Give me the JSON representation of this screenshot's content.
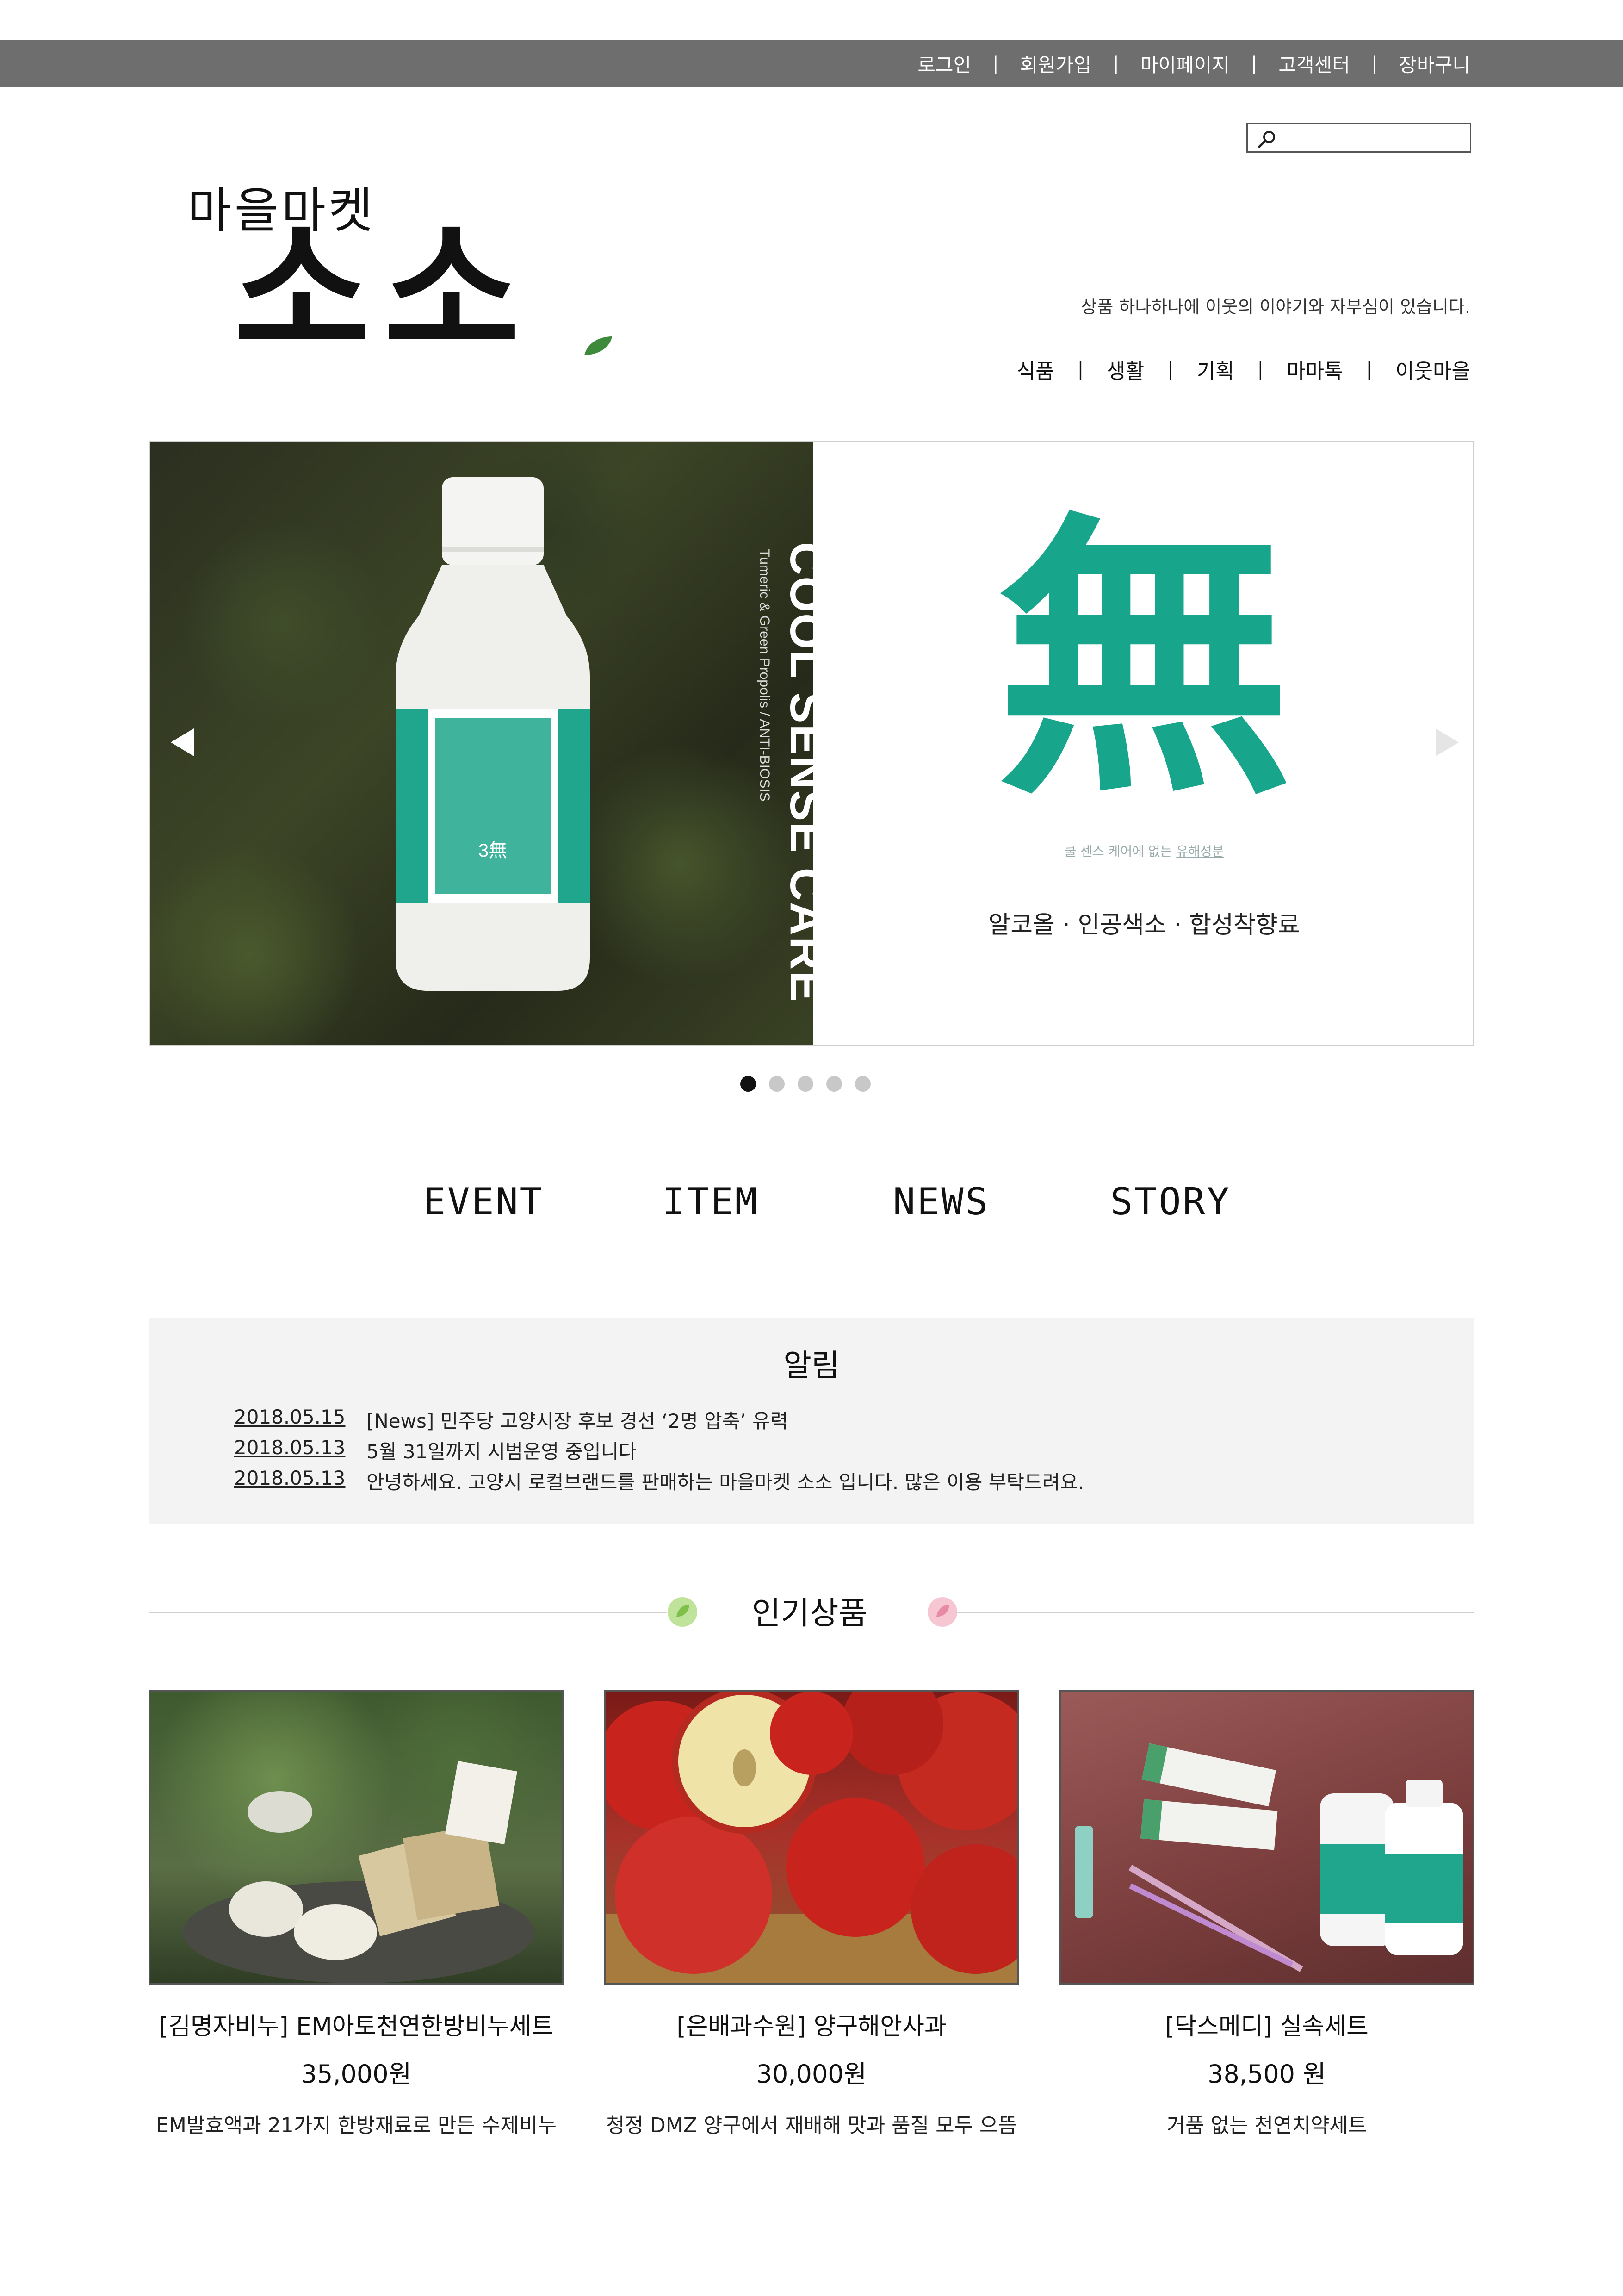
{
  "top_nav": [
    {
      "label": "로그인"
    },
    {
      "label": "회원가입"
    },
    {
      "label": "마이페이지"
    },
    {
      "label": "고객센터"
    },
    {
      "label": "장바구니"
    }
  ],
  "search": {
    "placeholder": "",
    "icon": "search-icon"
  },
  "logo": {
    "small": "마을마켓",
    "big": "소소"
  },
  "tagline": "상품 하나하나에 이웃의 이야기와 자부심이 있습니다.",
  "category_nav": [
    {
      "label": "식품"
    },
    {
      "label": "생활"
    },
    {
      "label": "기획"
    },
    {
      "label": "마마톡"
    },
    {
      "label": "이웃마을"
    }
  ],
  "hero": {
    "bottle_brand": "COOL SENSE CARE",
    "bottle_sub": "Tumeric & Green Propolis / ANTI-BIOSIS",
    "symbol": "無",
    "caption_prefix": "쿨 센스 케어에 없는 ",
    "caption_underlined": "유해성분",
    "headline": "알코올 · 인공색소 · 합성착향료",
    "slide_count": 5,
    "active_slide": 1
  },
  "section_tabs": [
    {
      "label": "EVENT"
    },
    {
      "label": "ITEM"
    },
    {
      "label": "NEWS"
    },
    {
      "label": "STORY"
    }
  ],
  "notice": {
    "title": "알림",
    "items": [
      {
        "date": "2018.05.15",
        "text": "[News] 민주당 고양시장 후보 경선 ‘2명 압축’ 유력"
      },
      {
        "date": "2018.05.13",
        "text": "5월 31일까지 시범운영 중입니다"
      },
      {
        "date": "2018.05.13",
        "text": "안녕하세요. 고양시 로컬브랜드를 판매하는 마을마켓 소소 입니다. 많은 이용 부탁드려요."
      }
    ]
  },
  "popular": {
    "title": "인기상품",
    "products": [
      {
        "name": "[김명자비누] EM아토천연한방비누세트",
        "price": "35,000원",
        "desc": "EM발효액과 21가지 한방재료로 만든 수제비누"
      },
      {
        "name": "[은배과수원] 양구해안사과",
        "price": "30,000원",
        "desc": "청정 DMZ 양구에서 재배해 맛과 품질 모두 으뜸"
      },
      {
        "name": "[닥스메디] 실속세트",
        "price": "38,500 원",
        "desc": "거품 없는 천연치약세트"
      }
    ]
  },
  "colors": {
    "accent": "#17a58b",
    "topbar": "#6e6e6e",
    "notice_bg": "#f3f3f3"
  }
}
